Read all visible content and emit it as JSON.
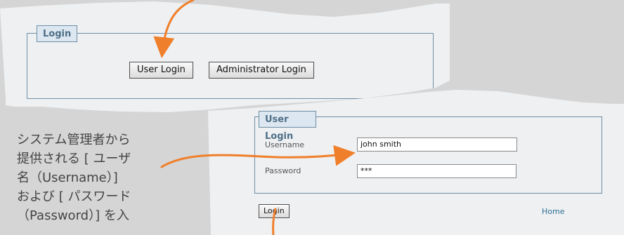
{
  "top_login_panel": {
    "legend": "Login",
    "user_login_button": "User Login",
    "administrator_login_button": "Administrator Login"
  },
  "user_login_panel": {
    "legend": "User Login",
    "username_label": "Username",
    "username_value": "john smith",
    "password_label": "Password",
    "password_value": "***",
    "login_button": "Login",
    "home_link": "Home"
  },
  "annotation": {
    "lines": [
      "システム管理者から",
      "提供される [ ユーザ",
      "名（Username）]",
      "および [ パスワード",
      "（Password）] を入"
    ]
  },
  "colors": {
    "arrow": "#f07f2b",
    "legend_bg": "#dce7f1",
    "border": "#6f8ea6",
    "link": "#2f6f93"
  }
}
